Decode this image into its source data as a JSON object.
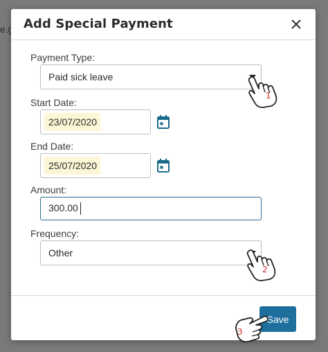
{
  "background": {
    "partial_text": "e.g"
  },
  "modal": {
    "title": "Add Special Payment",
    "close_icon": "close-icon",
    "fields": {
      "payment_type": {
        "label": "Payment Type:",
        "value": "Paid sick leave"
      },
      "start_date": {
        "label": "Start Date:",
        "value": "23/07/2020"
      },
      "end_date": {
        "label": "End Date:",
        "value": "25/07/2020"
      },
      "amount": {
        "label": "Amount:",
        "value": "300.00"
      },
      "frequency": {
        "label": "Frequency:",
        "value": "Other"
      }
    },
    "save_label": "Save"
  },
  "annotations": {
    "step1": "1",
    "step2": "2",
    "step3": "3"
  },
  "colors": {
    "primary": "#1f6f9e",
    "calendar_icon": "#1b6a8a",
    "date_highlight": "#fdf6d6",
    "step_number": "#d32f2f"
  }
}
